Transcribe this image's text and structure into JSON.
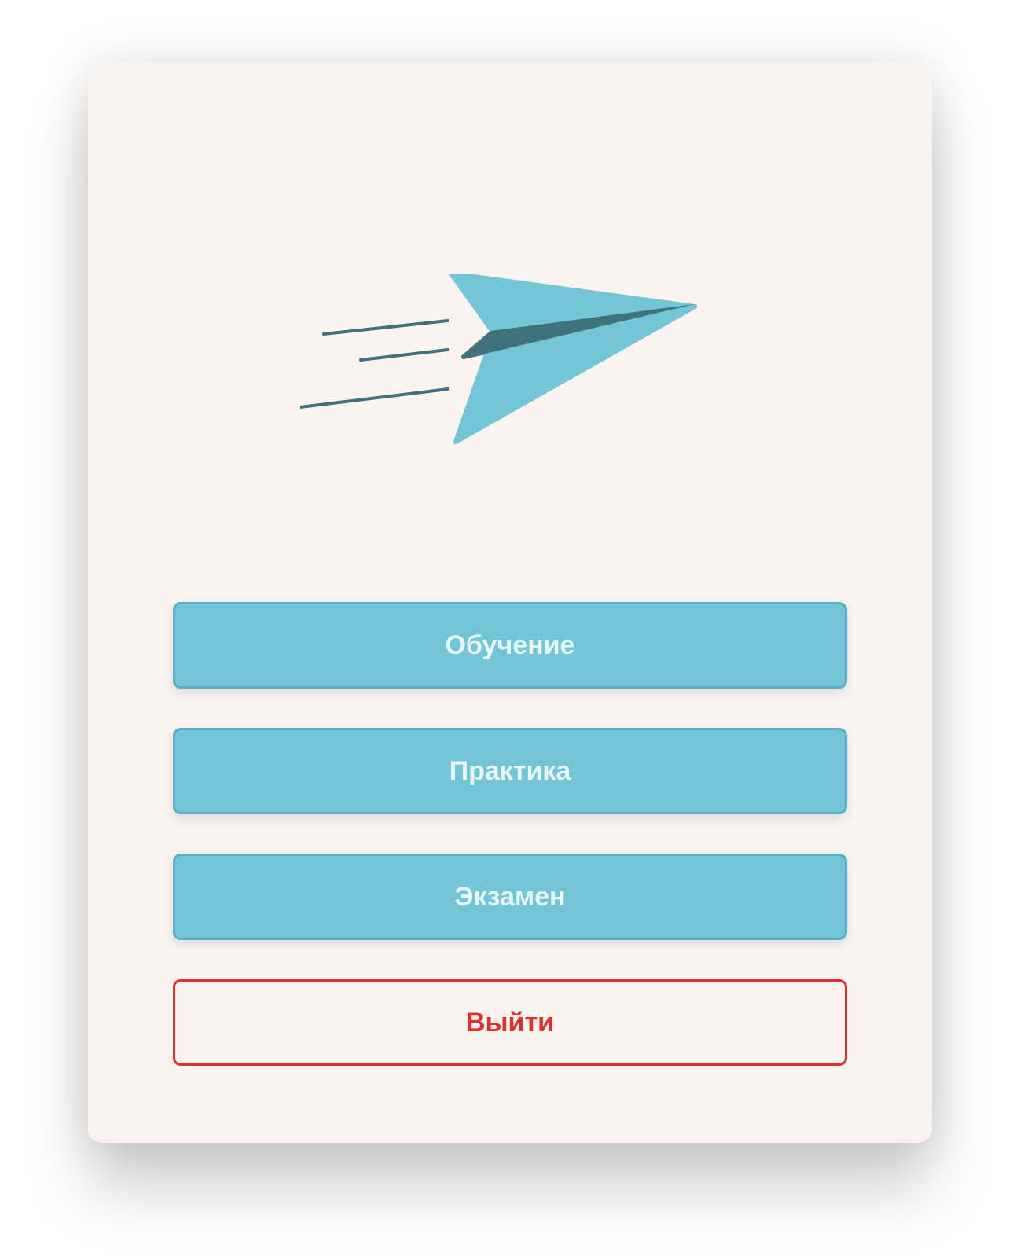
{
  "colors": {
    "background": "#faf3ef",
    "primary": "#71c5d4",
    "primary_border": "#5aaec6",
    "primary_text": "#e9f7fb",
    "danger": "#e0302c",
    "plane_light": "#72c6d5",
    "plane_dark": "#3f727b"
  },
  "logo": {
    "icon": "paper-plane-icon"
  },
  "menu": {
    "buttons": [
      {
        "label": "Обучение"
      },
      {
        "label": "Практика"
      },
      {
        "label": "Экзамен"
      }
    ],
    "exit_label": "Выйти"
  }
}
